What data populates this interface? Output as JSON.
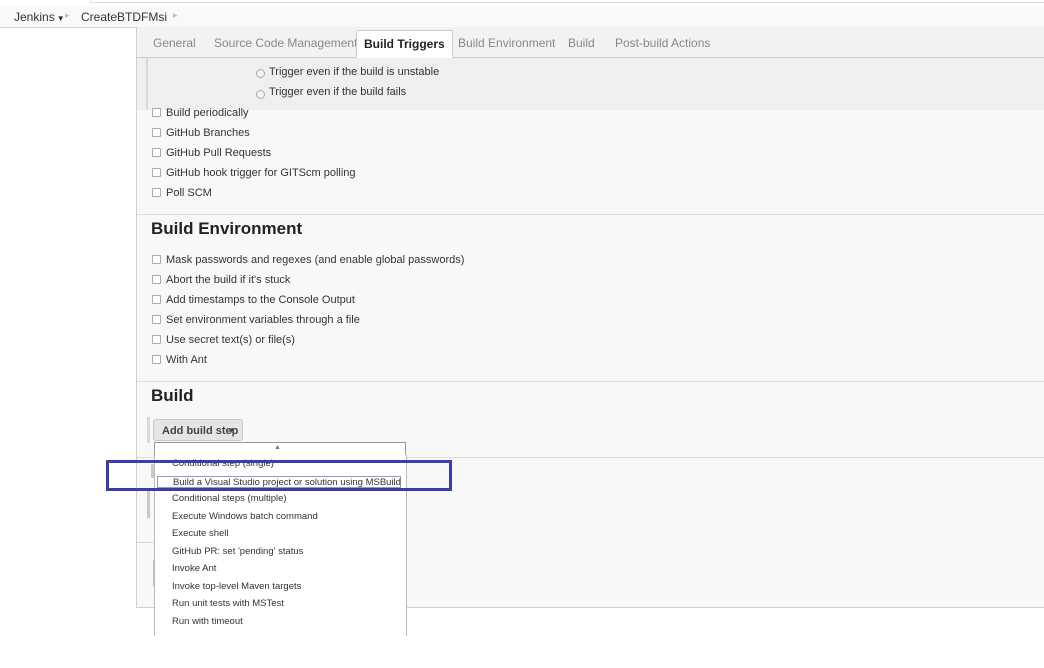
{
  "breadcrumb": {
    "items": [
      "Jenkins",
      "CreateBTDFMsi"
    ]
  },
  "tabs": [
    {
      "label": "General",
      "active": false
    },
    {
      "label": "Source Code Management",
      "active": false
    },
    {
      "label": "Build Triggers",
      "active": true
    },
    {
      "label": "Build Environment",
      "active": false
    },
    {
      "label": "Build",
      "active": false
    },
    {
      "label": "Post-build Actions",
      "active": false
    }
  ],
  "trigger_radios": [
    "Trigger even if the build is unstable",
    "Trigger even if the build fails"
  ],
  "triggers": [
    "Build periodically",
    "GitHub Branches",
    "GitHub Pull Requests",
    "GitHub hook trigger for GITScm polling",
    "Poll SCM"
  ],
  "build_environment": {
    "title": "Build Environment",
    "options": [
      "Mask passwords and regexes (and enable global passwords)",
      "Abort the build if it's stuck",
      "Add timestamps to the Console Output",
      "Set environment variables through a file",
      "Use secret text(s) or file(s)",
      "With Ant"
    ]
  },
  "build": {
    "title": "Build",
    "add_step_label": "Add build step"
  },
  "menu": {
    "items": [
      "Conditional step (single)",
      "Build a Visual Studio project or solution using MSBuild",
      "Conditional steps (multiple)",
      "Execute Windows batch command",
      "Execute shell",
      "GitHub PR: set 'pending' status",
      "Invoke Ant",
      "Invoke top-level Maven targets",
      "Run unit tests with MSTest",
      "Run with timeout"
    ],
    "selected_index": 1
  },
  "colors": {
    "highlight": "#3b3ea8",
    "panel_bg": "#f8f8f8"
  }
}
